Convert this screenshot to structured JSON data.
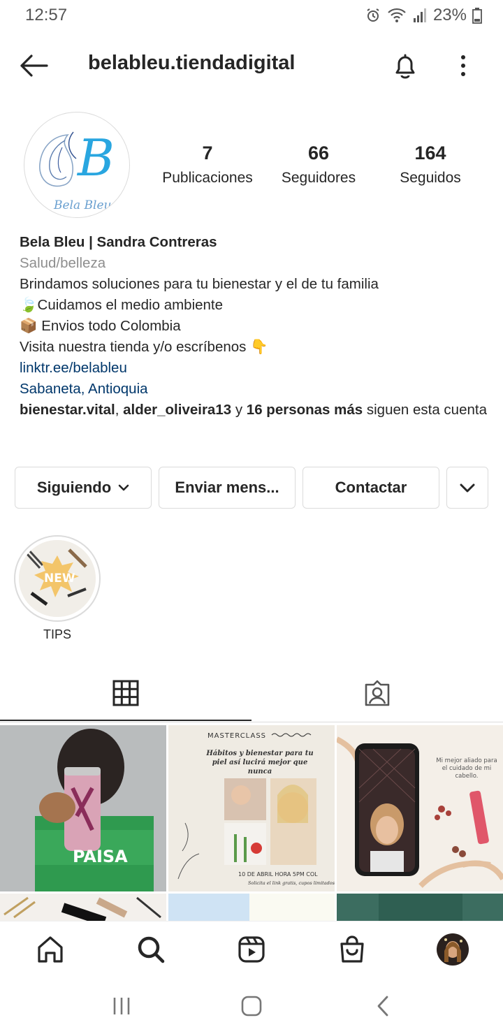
{
  "status": {
    "time": "12:57",
    "battery": "23%"
  },
  "header": {
    "username": "belableu.tiendadigital"
  },
  "profile": {
    "avatar_text": "B",
    "avatar_script": "Bela Bleu",
    "stats": [
      {
        "value": "7",
        "label": "Publicaciones"
      },
      {
        "value": "66",
        "label": "Seguidores"
      },
      {
        "value": "164",
        "label": "Seguidos"
      }
    ],
    "name": "Bela Bleu | Sandra Contreras",
    "category": "Salud/belleza",
    "bio_lines": [
      "Brindamos soluciones para tu bienestar y el de tu familia",
      "🍃Cuidamos el medio ambiente",
      "📦  Envios todo Colombia",
      "Visita nuestra tienda y/o escríbenos 👇"
    ],
    "link": "linktr.ee/belableu",
    "location": "Sabaneta, Antioquia",
    "followed_by": {
      "user1": "bienestar.vital",
      "sep": ", ",
      "user2": "alder_oliveira13",
      "and": " y ",
      "others": "16 personas más",
      "suffix": " siguen esta cuenta"
    }
  },
  "actions": {
    "following": "Siguiendo",
    "message": "Enviar mens...",
    "contact": "Contactar"
  },
  "highlights": [
    {
      "label": "TIPS",
      "badge": "NEW"
    }
  ],
  "grid": {
    "post1_text": "PAISA",
    "post2_title": "MASTERCLASS",
    "post2_subtitle": "Hábitos y bienestar para tu piel así lucirá mejor que nunca",
    "post2_date": "10 DE ABRIL HORA 5PM COL",
    "post2_note": "Solicita el link gratis, cupos limitados",
    "post3_text": "Mi mejor aliado para el cuidado de mi cabello."
  },
  "colors": {
    "link": "#00376b",
    "secondary_text": "#8e8e8e",
    "border": "#dbdbdb",
    "brand_blue": "#29a6e0"
  }
}
